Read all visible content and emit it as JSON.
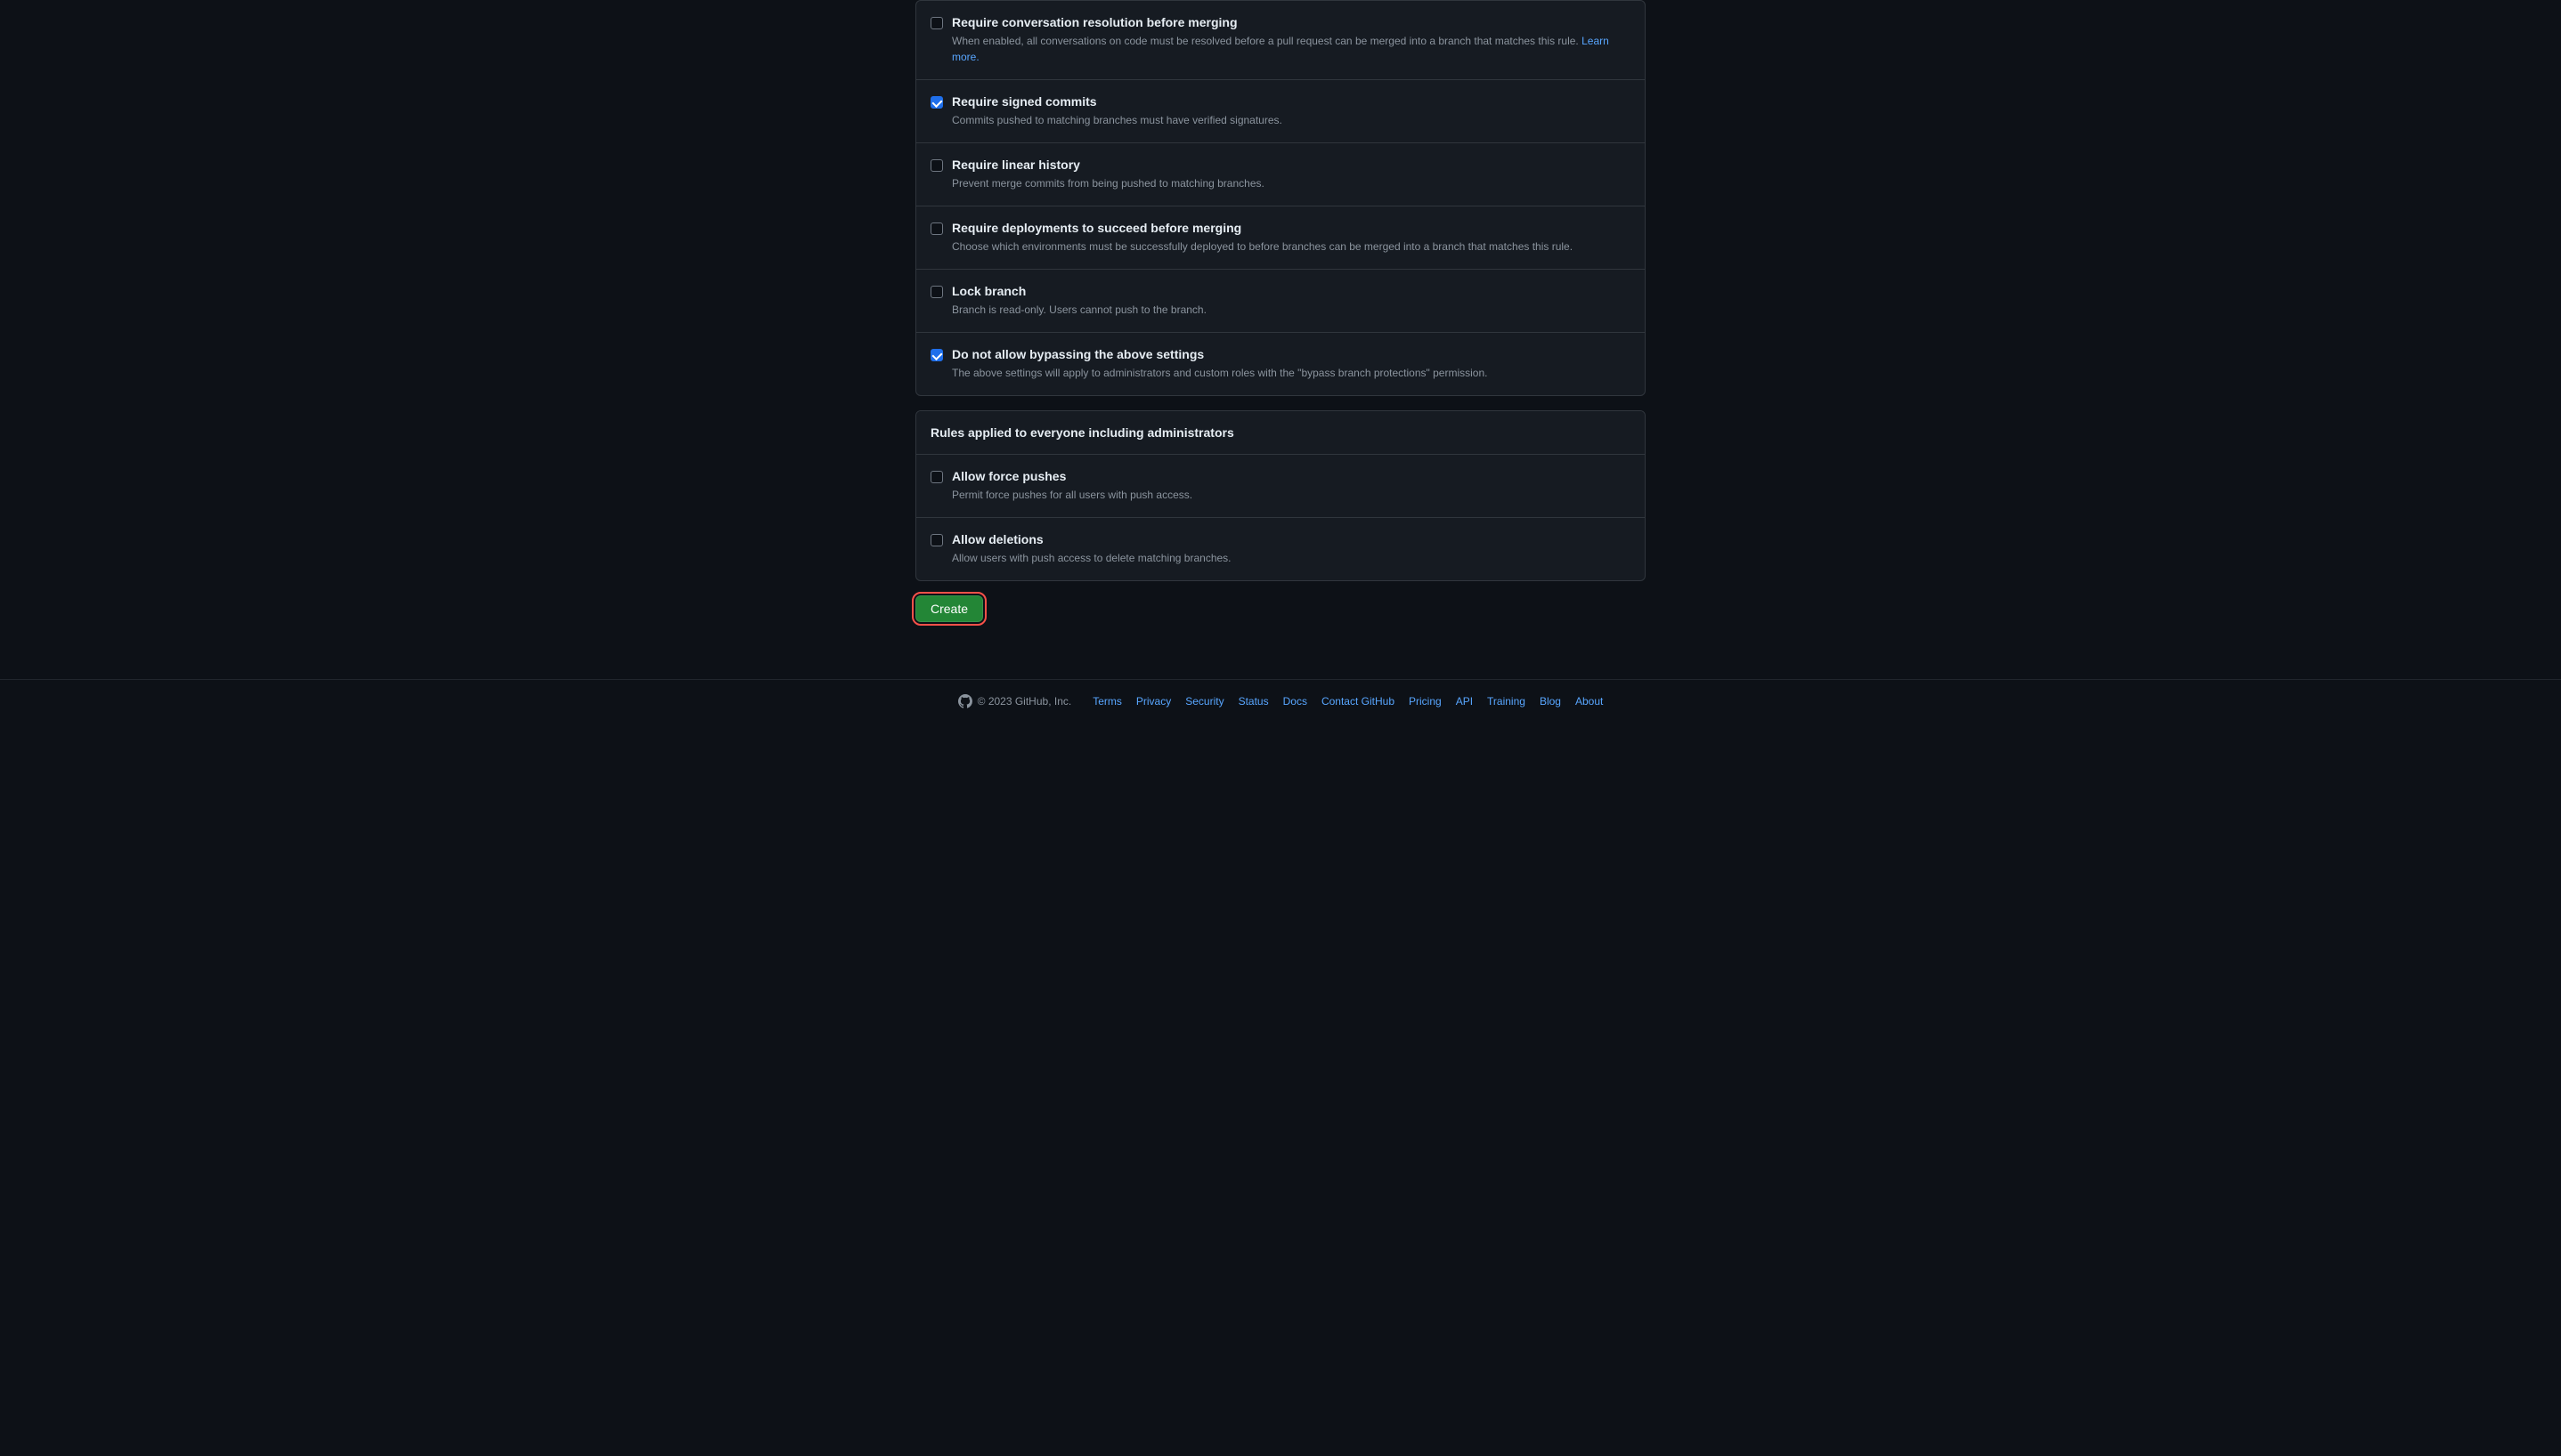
{
  "rules": [
    {
      "id": "require-conversation-resolution",
      "title": "Require conversation resolution before merging",
      "description": "When enabled, all conversations on code must be resolved before a pull request can be merged into a branch that matches this rule.",
      "link_text": "Learn more.",
      "link_href": "#",
      "checked": false
    },
    {
      "id": "require-signed-commits",
      "title": "Require signed commits",
      "description": "Commits pushed to matching branches must have verified signatures.",
      "link_text": null,
      "link_href": null,
      "checked": true
    },
    {
      "id": "require-linear-history",
      "title": "Require linear history",
      "description": "Prevent merge commits from being pushed to matching branches.",
      "link_text": null,
      "link_href": null,
      "checked": false
    },
    {
      "id": "require-deployments",
      "title": "Require deployments to succeed before merging",
      "description": "Choose which environments must be successfully deployed to before branches can be merged into a branch that matches this rule.",
      "link_text": null,
      "link_href": null,
      "checked": false
    },
    {
      "id": "lock-branch",
      "title": "Lock branch",
      "description": "Branch is read-only. Users cannot push to the branch.",
      "link_text": null,
      "link_href": null,
      "checked": false
    },
    {
      "id": "do-not-allow-bypassing",
      "title": "Do not allow bypassing the above settings",
      "description": "The above settings will apply to administrators and custom roles with the \"bypass branch protections\" permission.",
      "link_text": null,
      "link_href": null,
      "checked": true
    }
  ],
  "rules_everyone_section": {
    "header": "Rules applied to everyone including administrators",
    "items": [
      {
        "id": "allow-force-pushes",
        "title": "Allow force pushes",
        "description": "Permit force pushes for all users with push access.",
        "checked": false
      },
      {
        "id": "allow-deletions",
        "title": "Allow deletions",
        "description": "Allow users with push access to delete matching branches.",
        "checked": false
      }
    ]
  },
  "create_button_label": "Create",
  "footer": {
    "copyright": "© 2023 GitHub, Inc.",
    "links": [
      {
        "label": "Terms",
        "href": "#"
      },
      {
        "label": "Privacy",
        "href": "#"
      },
      {
        "label": "Security",
        "href": "#"
      },
      {
        "label": "Status",
        "href": "#"
      },
      {
        "label": "Docs",
        "href": "#"
      },
      {
        "label": "Contact GitHub",
        "href": "#"
      },
      {
        "label": "Pricing",
        "href": "#"
      },
      {
        "label": "API",
        "href": "#"
      },
      {
        "label": "Training",
        "href": "#"
      },
      {
        "label": "Blog",
        "href": "#"
      },
      {
        "label": "About",
        "href": "#"
      }
    ]
  }
}
